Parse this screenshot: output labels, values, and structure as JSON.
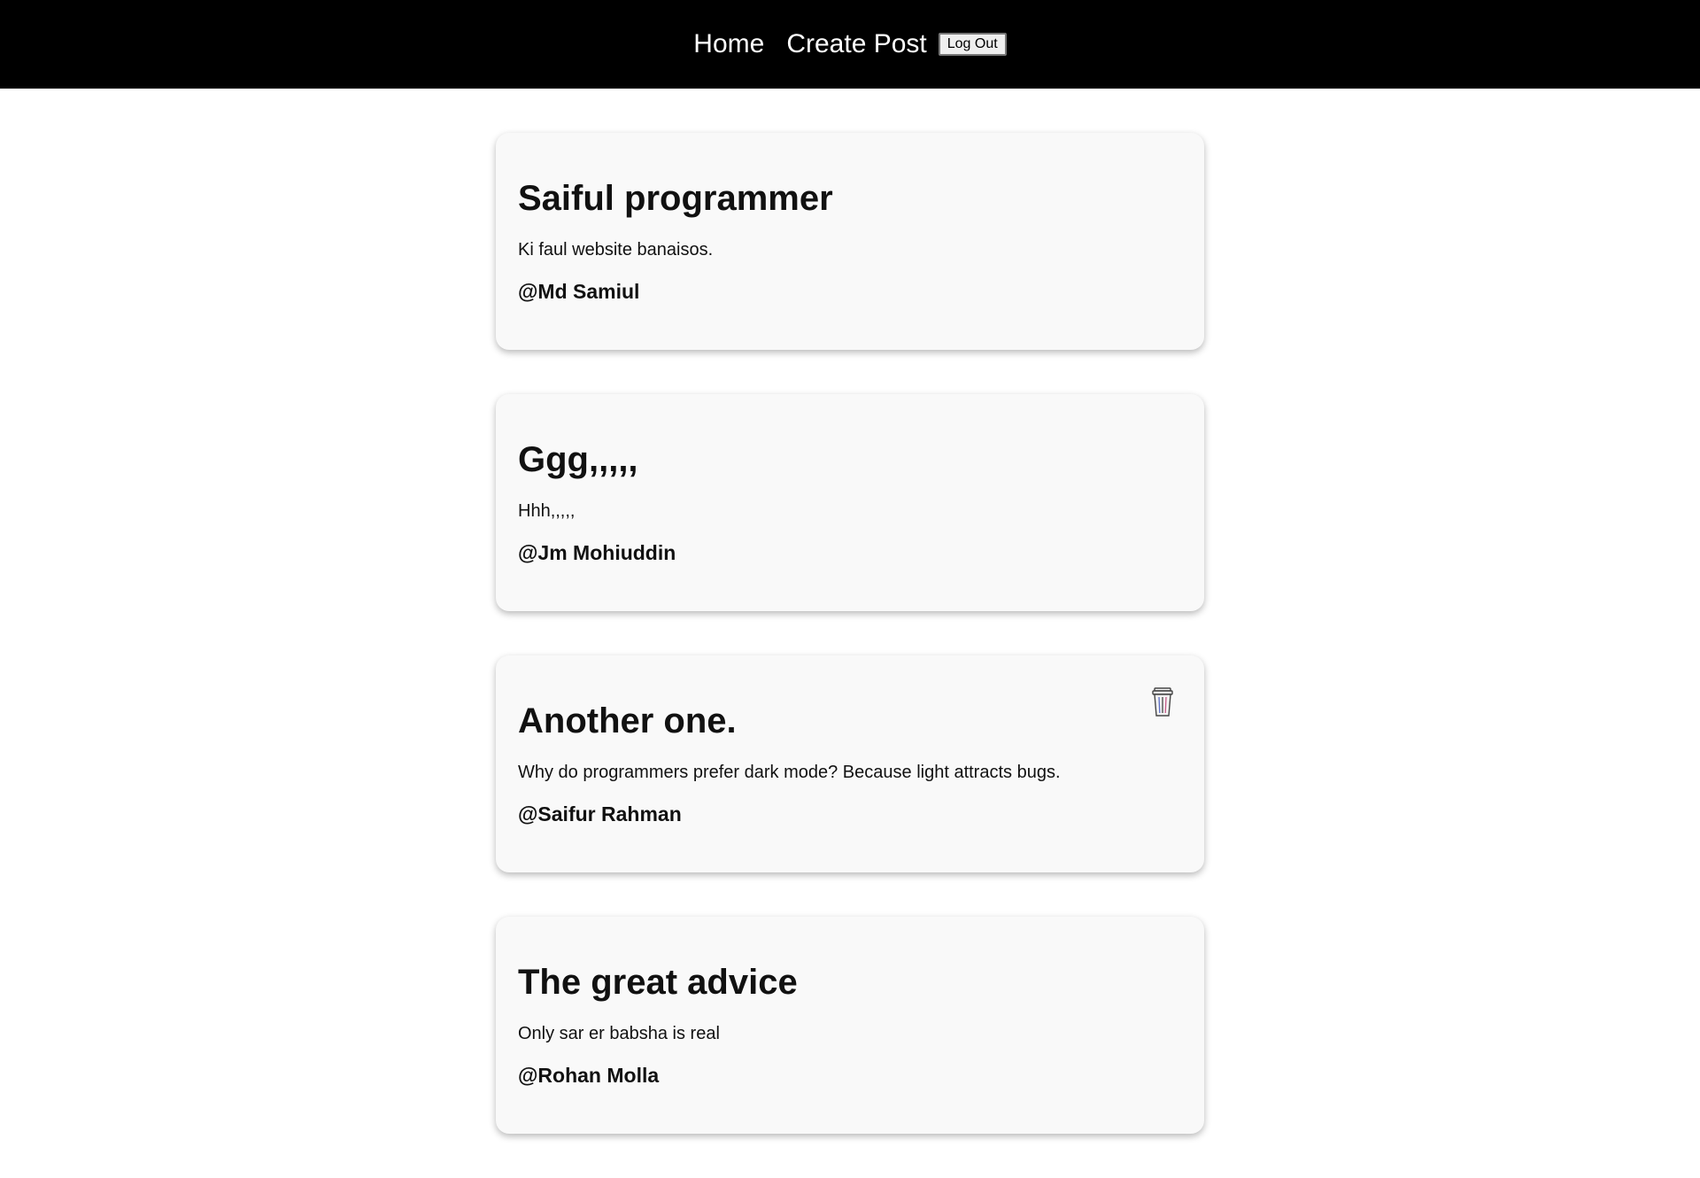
{
  "navbar": {
    "home_label": "Home",
    "create_post_label": "Create Post",
    "logout_label": "Log Out"
  },
  "posts": [
    {
      "title": "Saiful programmer",
      "body": "Ki faul website banaisos.",
      "author": "@Md Samiul",
      "has_delete": false
    },
    {
      "title": "Ggg,,,,,",
      "body": "Hhh,,,,,",
      "author": "@Jm Mohiuddin",
      "has_delete": false
    },
    {
      "title": "Another one.",
      "body": "Why do programmers prefer dark mode? Because light attracts bugs.",
      "author": "@Saifur Rahman",
      "has_delete": true,
      "delete_icon": "trash-can-icon"
    },
    {
      "title": "The great advice",
      "body": "Only sar er babsha is real",
      "author": "@Rohan Molla",
      "has_delete": false
    }
  ]
}
